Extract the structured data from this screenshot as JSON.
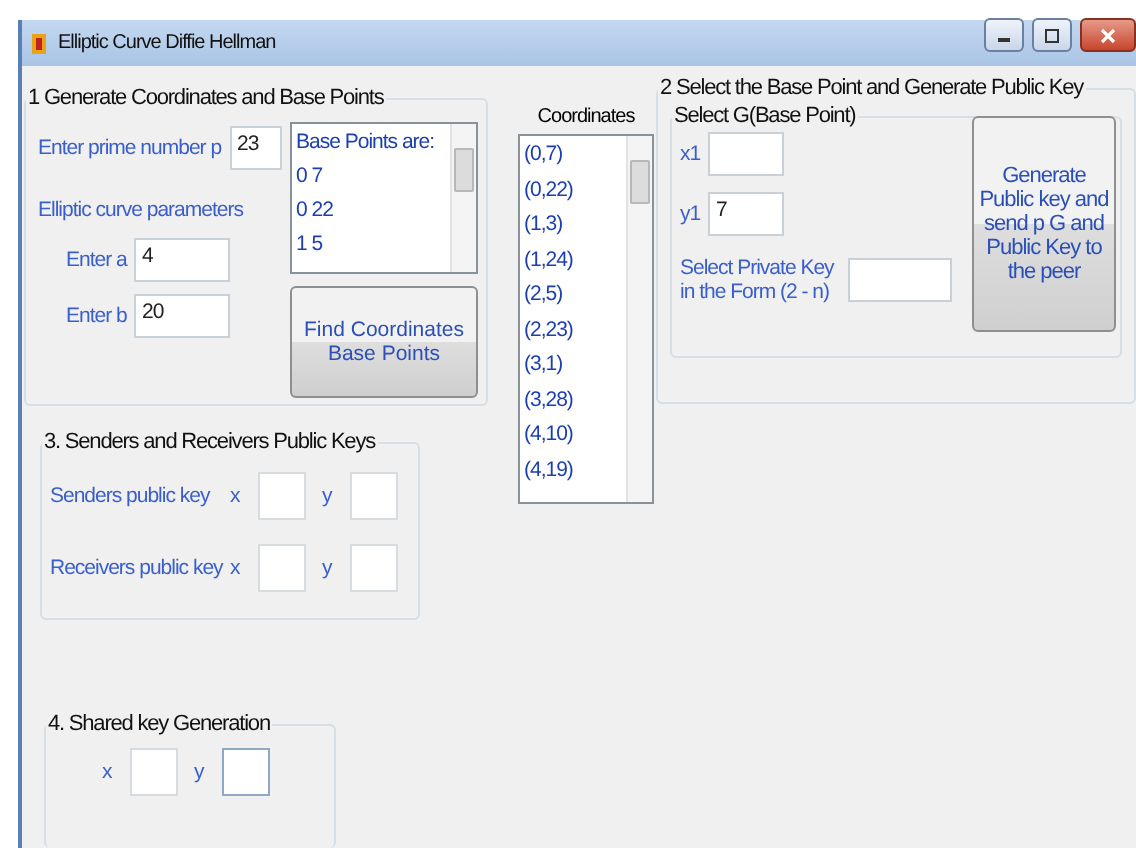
{
  "window": {
    "title": "Elliptic Curve Diffie Hellman"
  },
  "group1": {
    "title": "1 Generate Coordinates and Base Points",
    "prime_label": "Enter prime number p",
    "prime_value": "23",
    "params_label": "Elliptic curve parameters",
    "a_label": "Enter a",
    "a_value": "4",
    "b_label": "Enter b",
    "b_value": "20",
    "base_points": [
      "Base Points are:",
      "0 7",
      "0 22",
      "1 5"
    ],
    "button": "Find Coordinates Base Points"
  },
  "coordinates": {
    "title": "Coordinates",
    "items": [
      "(0,7)",
      "(0,22)",
      "(1,3)",
      "(1,24)",
      "(2,5)",
      "(2,23)",
      "(3,1)",
      "(3,28)",
      "(4,10)",
      "(4,19)"
    ]
  },
  "group2": {
    "title": "2 Select the Base Point and Generate Public Key",
    "inner_title": "Select G(Base Point)",
    "x1_label": "x1",
    "y1_label": "y1",
    "y1_value": "7",
    "private_label": "Select Private Key in the Form (2 - n)",
    "button": "Generate Public key and send p G and Public Key to the peer"
  },
  "group3": {
    "title": "3. Senders and Receivers Public Keys",
    "rows": [
      {
        "label": "Senders public key",
        "x_label": "x",
        "y_label": "y"
      },
      {
        "label": "Receivers public key",
        "x_label": "x",
        "y_label": "y"
      }
    ]
  },
  "group4": {
    "title": "4. Shared key Generation",
    "x_label": "x",
    "y_label": "y"
  }
}
